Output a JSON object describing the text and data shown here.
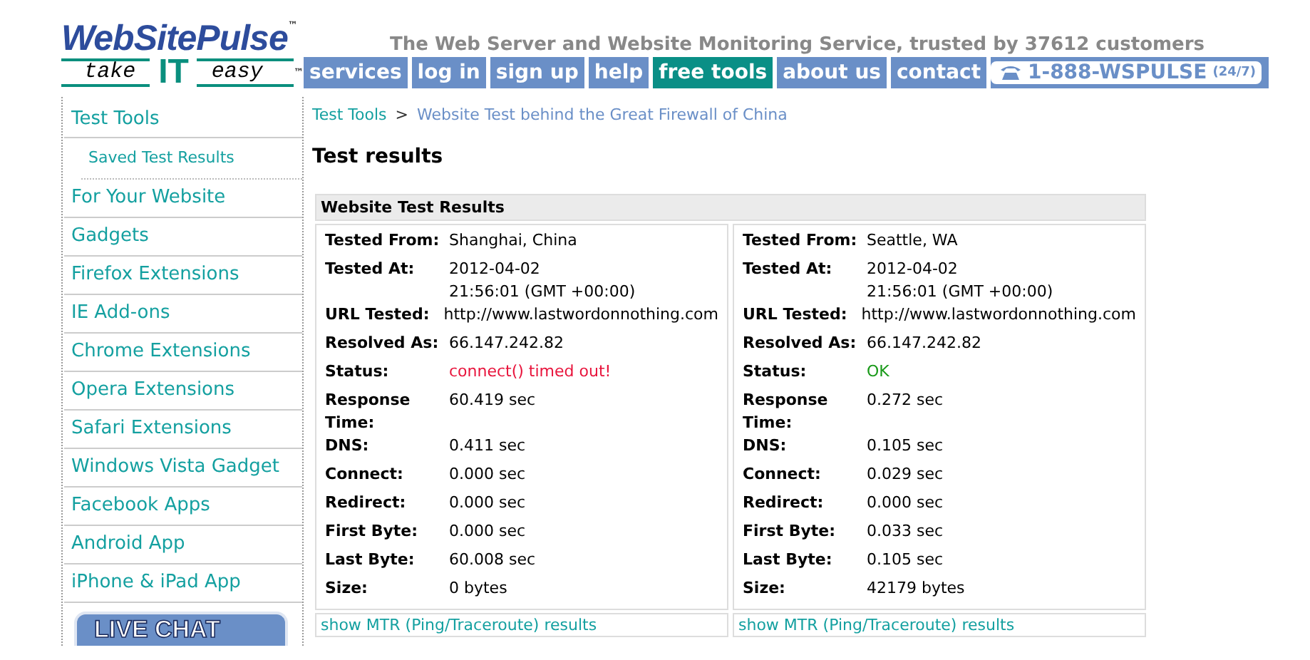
{
  "logo": {
    "name": "WebSitePulse",
    "tm": "™",
    "slogan_left": "take",
    "slogan_mid": "IT",
    "slogan_right": "easy",
    "slogan_tm": "™"
  },
  "tagline": "The Web Server and Website Monitoring Service, trusted by 37612 customers",
  "nav": [
    {
      "label": "services",
      "selected": false
    },
    {
      "label": "log in",
      "selected": false
    },
    {
      "label": "sign up",
      "selected": false
    },
    {
      "label": "help",
      "selected": false
    },
    {
      "label": "free tools",
      "selected": true
    },
    {
      "label": "about us",
      "selected": false
    },
    {
      "label": "contact",
      "selected": false
    }
  ],
  "phone": {
    "number": "1-888-WSPULSE",
    "hours": "(24/7)"
  },
  "sidebar": {
    "items": [
      {
        "label": "Test Tools",
        "kind": "section"
      },
      {
        "label": "Saved Test Results",
        "kind": "sub"
      },
      {
        "label": "For Your Website",
        "kind": "section"
      },
      {
        "label": "Gadgets",
        "kind": "section"
      },
      {
        "label": "Firefox Extensions",
        "kind": "section"
      },
      {
        "label": "IE Add-ons",
        "kind": "section"
      },
      {
        "label": "Chrome Extensions",
        "kind": "section"
      },
      {
        "label": "Opera Extensions",
        "kind": "section"
      },
      {
        "label": "Safari Extensions",
        "kind": "section"
      },
      {
        "label": "Windows Vista Gadget",
        "kind": "section"
      },
      {
        "label": "Facebook Apps",
        "kind": "section"
      },
      {
        "label": "Android App",
        "kind": "section"
      },
      {
        "label": "iPhone & iPad App",
        "kind": "section"
      }
    ],
    "live_chat": "LIVE CHAT"
  },
  "breadcrumb": {
    "link": "Test Tools",
    "separator": ">",
    "current": "Website Test behind the Great Firewall of China"
  },
  "heading": "Test results",
  "results": {
    "title": "Website Test Results",
    "columns": [
      {
        "rows": [
          {
            "label": "Tested From:",
            "value": [
              "Shanghai, China"
            ]
          },
          {
            "label": "Tested At:",
            "value": [
              "2012-04-02",
              "21:56:01 (GMT +00:00)"
            ]
          },
          {
            "label": "URL Tested:",
            "value": [
              "http://www.lastwordonnothing.com"
            ]
          },
          {
            "label": "Resolved As:",
            "value": [
              "66.147.242.82"
            ]
          },
          {
            "label": "Status:",
            "value": [
              "connect() timed out!"
            ],
            "color": "#e8143c"
          },
          {
            "label": "Response Time:",
            "value": [
              "60.419 sec"
            ]
          },
          {
            "label": "DNS:",
            "value": [
              "0.411 sec"
            ]
          },
          {
            "label": "Connect:",
            "value": [
              "0.000 sec"
            ]
          },
          {
            "label": "Redirect:",
            "value": [
              "0.000 sec"
            ]
          },
          {
            "label": "First Byte:",
            "value": [
              "0.000 sec"
            ]
          },
          {
            "label": "Last Byte:",
            "value": [
              "60.008 sec"
            ]
          },
          {
            "label": "Size:",
            "value": [
              "0 bytes"
            ]
          }
        ],
        "mtr_link": "show MTR (Ping/Traceroute) results"
      },
      {
        "rows": [
          {
            "label": "Tested From:",
            "value": [
              "Seattle, WA"
            ]
          },
          {
            "label": "Tested At:",
            "value": [
              "2012-04-02",
              "21:56:01 (GMT +00:00)"
            ]
          },
          {
            "label": "URL Tested:",
            "value": [
              "http://www.lastwordonnothing.com"
            ]
          },
          {
            "label": "Resolved As:",
            "value": [
              "66.147.242.82"
            ]
          },
          {
            "label": "Status:",
            "value": [
              "OK"
            ],
            "color": "#1a9a1a"
          },
          {
            "label": "Response Time:",
            "value": [
              "0.272 sec"
            ]
          },
          {
            "label": "DNS:",
            "value": [
              "0.105 sec"
            ]
          },
          {
            "label": "Connect:",
            "value": [
              "0.029 sec"
            ]
          },
          {
            "label": "Redirect:",
            "value": [
              "0.000 sec"
            ]
          },
          {
            "label": "First Byte:",
            "value": [
              "0.033 sec"
            ]
          },
          {
            "label": "Last Byte:",
            "value": [
              "0.105 sec"
            ]
          },
          {
            "label": "Size:",
            "value": [
              "42179 bytes"
            ]
          }
        ],
        "mtr_link": "show MTR (Ping/Traceroute) results"
      }
    ]
  }
}
